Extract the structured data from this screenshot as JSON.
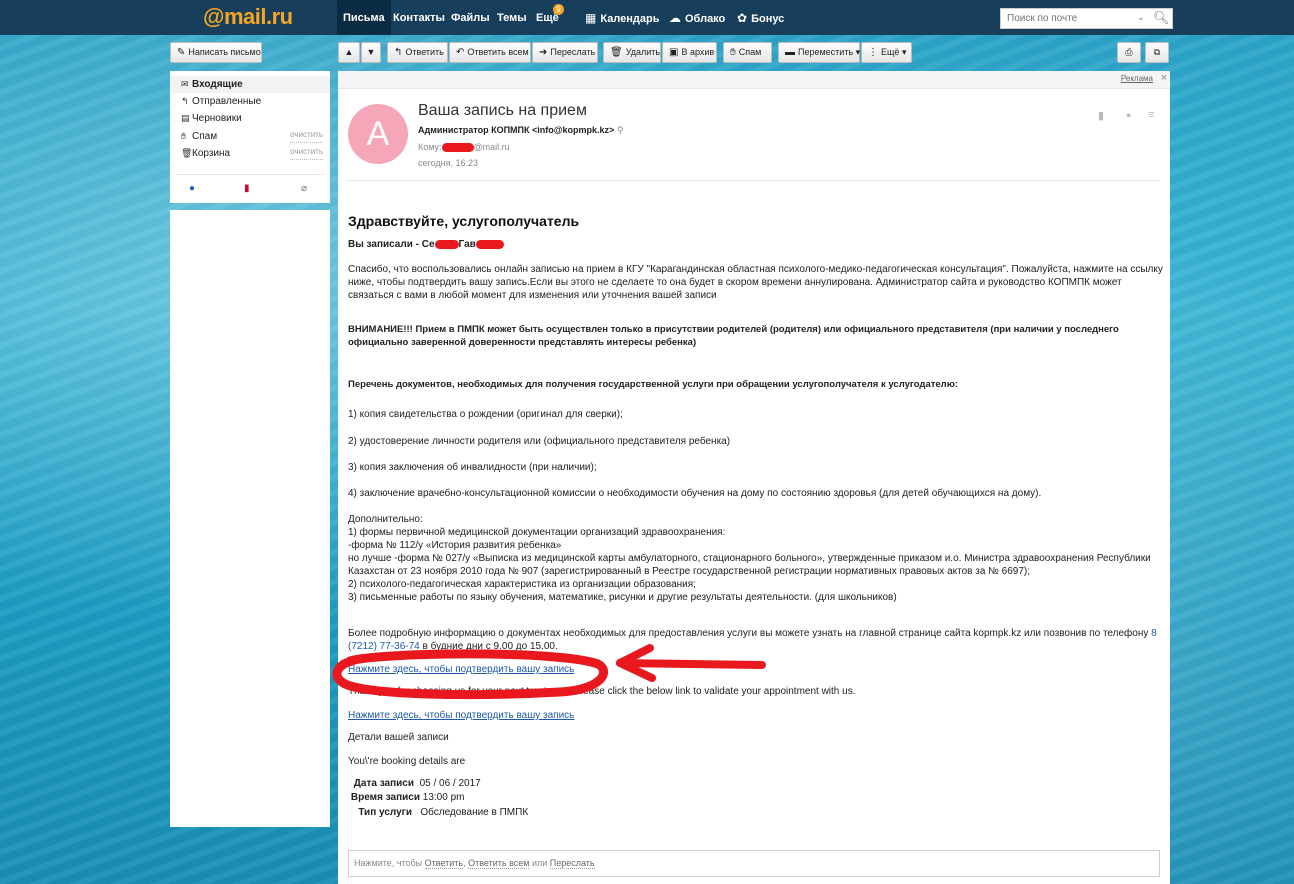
{
  "brand": {
    "logo": "@mail.ru",
    "accent": "#f5a623"
  },
  "nav": {
    "items": [
      "Письма",
      "Контакты",
      "Файлы",
      "Темы",
      "Ещё",
      "Календарь",
      "Облако",
      "Бонус"
    ],
    "more_badge": "9",
    "search_placeholder": "Поиск по почте"
  },
  "toolbar": {
    "compose": "Написать письмо",
    "reply": "Ответить",
    "reply_all": "Ответить всем",
    "forward": "Переслать",
    "delete": "Удалить",
    "archive": "В архив",
    "spam": "Спам",
    "move": "Переместить",
    "more": "Ещё"
  },
  "folders": {
    "inbox": "Входящие",
    "sent": "Отправленные",
    "drafts": "Черновики",
    "spam": "Спам",
    "trash": "Корзина",
    "clean": "очистить"
  },
  "ad": {
    "label": "Реклама"
  },
  "message": {
    "avatar_letter": "А",
    "subject": "Ваша запись на прием",
    "sender": "Администратор КОПМПК <info@kopmpk.kz>",
    "to_label": "Кому:",
    "to_domain": "@mail.ru",
    "date": "сегодня, 16:23",
    "greeting": "Здравствуйте, услугополучатель",
    "registered_prefix": "Вы записали - Се",
    "registered_mid": "Гав",
    "thanks": "Спасибо, что воспользовались онлайн записью на прием в КГУ \"Карагандинская областная психолого-медико-педагогическая консультация\". Пожалуйста, нажмите на ссылку ниже, чтобы подтвердить вашу запись.Если вы этого не сделаете то она будет в скором времени аннулирована. Администратор сайта и руководство КОПМПК может связаться с вами в любой момент для изменения или уточнения вашей записи",
    "warning": "ВНИМАНИЕ!!! Прием в ПМПК может быть осуществлен только в присутствии родителей (родителя) или официального представителя (при наличии у последнего официально заверенной доверенности представлять интересы ребенка)",
    "docs_title": "Перечень документов, необходимых для получения государственной услуги при обращении услугополучателя к услугодателю:",
    "doc1": "1) копия свидетельства о рождении (оригинал для сверки);",
    "doc2": "2) удостоверение личности родителя или (официального представителя ребенка)",
    "doc3": "3) копия заключения об инвалидности (при наличии);",
    "doc4": "4) заключение врачебно-консультационной комиссии о необходимости обучения на дому по состоянию здоровья (для детей обучающихся на дому).",
    "extra_title": "Дополнительно:",
    "extra1": "1) формы первичной медицинской документации организаций здравоохранения:",
    "extra2": "-форма № 112/у «История развития ребенка»",
    "extra3": "но лучше -форма № 027/у «Выписка из медицинской карты амбулаторного, стационарного больного», утвержденные приказом и.о. Министра здравоохранения Республики Казахстан от 23 ноября 2010 года № 907 (зарегистрированный в Реестре государственной регистрации нормативных правовых актов за № 6697);",
    "extra4": "2) психолого-педагогическая характеристика из организации образования;",
    "extra5": "3) письменные работы по языку обучения, математике, рисунки и другие результаты деятельности. (для школьников)",
    "info_text": "Более подробную информацию о документах необходимых для предоставления услуги вы можете узнать на главной странице сайта kopmpk.kz или позвонив по телефону ",
    "phone": "8 (7212) 77-36-74",
    "info_tail": " в будние дни с 9.00 до 15.00.",
    "confirm_link": "Нажмите здесь, чтобы подтвердить вашу запись",
    "thank_en": "Thank you for choosing us for your next treatment. Please click the below link to validate your appointment with us.",
    "details_title": "Детали вашей записи",
    "details_en": "You\\'re booking details are",
    "date_label": "Дата записи",
    "date_value": "05 / 06 / 2017",
    "time_label": "Время записи",
    "time_value": "13:00 pm",
    "type_label": "Тип услуги",
    "type_value": "Обследование в ПМПК"
  },
  "reply": {
    "prefix": "Нажмите, чтобы ",
    "reply": "Ответить",
    "sep1": ", ",
    "reply_all": "Ответить всем",
    "sep2": " или ",
    "forward": "Переслать"
  },
  "colors": {
    "topbar": "#173f5c",
    "annotation": "#e8181e",
    "link": "#1d5aa8"
  }
}
